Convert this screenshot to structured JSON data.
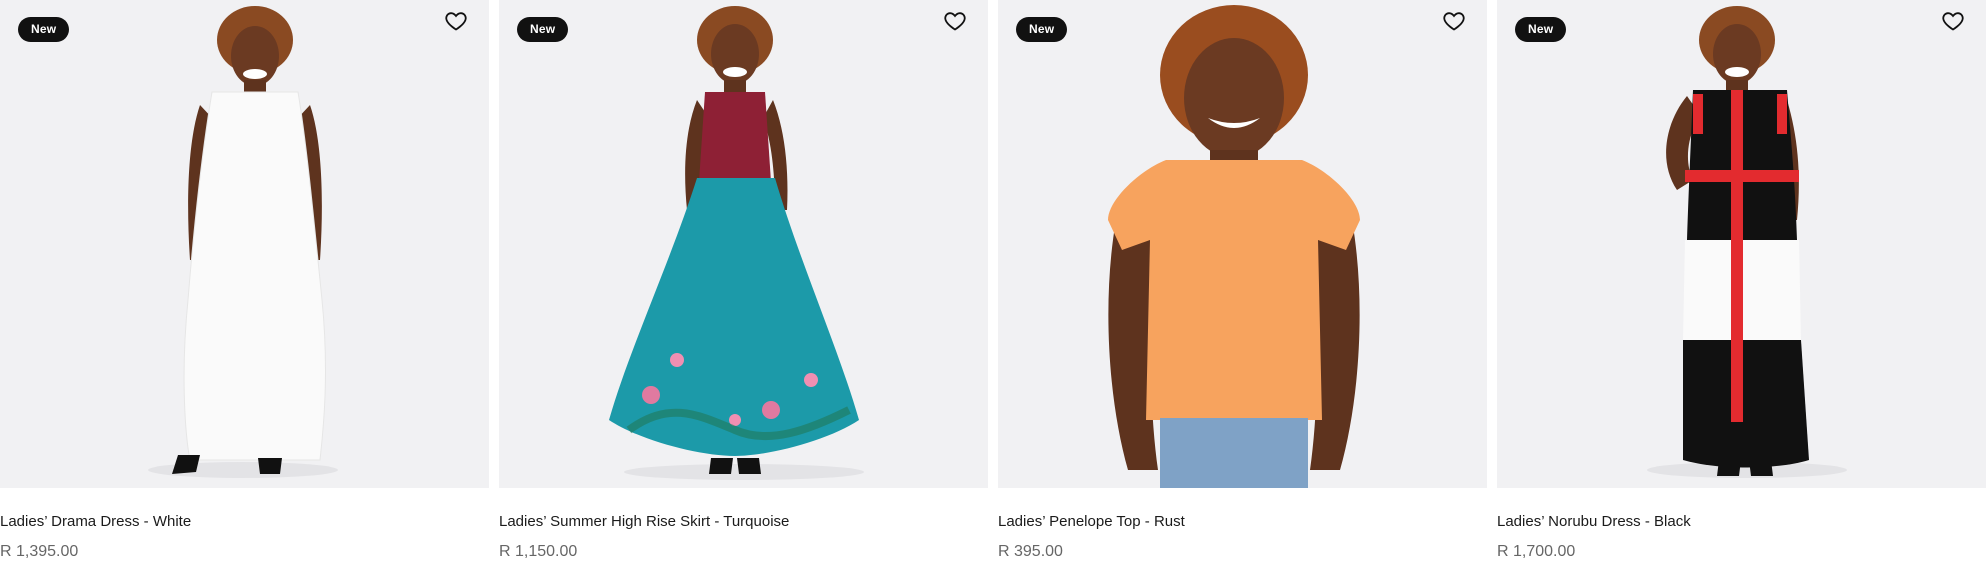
{
  "products": [
    {
      "badge": "New",
      "title": "Ladies’ Drama Dress - White",
      "price": "R 1,395.00",
      "garment_color": "#fafafa",
      "icons": [
        "heart-outline-icon"
      ]
    },
    {
      "badge": "New",
      "title": "Ladies’ Summer High Rise Skirt - Turquoise",
      "price": "R 1,150.00",
      "garment_color": "#1c9aa9",
      "icons": [
        "heart-outline-icon"
      ]
    },
    {
      "badge": "New",
      "title": "Ladies’ Penelope Top - Rust",
      "price": "R 395.00",
      "garment_color": "#f7a35e",
      "icons": [
        "heart-outline-icon"
      ]
    },
    {
      "badge": "New",
      "title": "Ladies’ Norubu Dress - Black",
      "price": "R 1,700.00",
      "garment_color": "#111111",
      "icons": [
        "heart-outline-icon"
      ]
    }
  ],
  "colors": {
    "background": "#ffffff",
    "image_background": "#f1f1f3",
    "badge_bg": "#111111",
    "badge_text": "#ffffff",
    "price_text": "#666666",
    "accent_red": "#e32b2f",
    "skirt_teal": "#1c9aa9",
    "top_maroon": "#8e2035"
  }
}
